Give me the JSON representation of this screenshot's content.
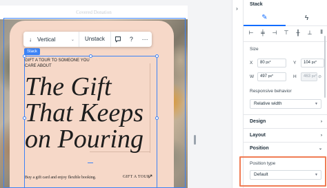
{
  "canvas": {
    "header_ghost": "Covered Donation",
    "stack_tag": "Stack",
    "small_text": "GIFT A TOUR TO SOMEONE YOU CARE ABOUT",
    "headline": "The Gift That Keeps on Pouring",
    "footer_text": "Buy a gift card and enjoy flexible booking.",
    "tour_link": "GIFT A TOUR",
    "tour_arrow_icon": "arrow-up-right-icon"
  },
  "toolbar": {
    "direction_label": "Vertical",
    "unstack_label": "Unstack",
    "icons": [
      "arrow-down-icon",
      "chevron-down-icon",
      "comment-icon",
      "help-icon",
      "more-icon"
    ]
  },
  "panel": {
    "title": "Stack",
    "tabs": [
      "design-tab",
      "interactions-tab"
    ],
    "size_label": "Size",
    "x_label": "X",
    "x_value": "80",
    "x_unit": "px*",
    "y_label": "Y",
    "y_value": "104",
    "y_unit": "px*",
    "w_label": "W",
    "w_value": "497",
    "w_unit": "px*",
    "h_label": "H",
    "h_value": "463",
    "h_unit": "px*",
    "responsive_label": "Responsive behavior",
    "responsive_value": "Relative width",
    "sections": {
      "design": "Design",
      "layout": "Layout",
      "position": "Position"
    },
    "position_type_label": "Position type",
    "position_type_value": "Default"
  },
  "colors": {
    "accent": "#116dff",
    "selection": "#3b82f6",
    "card": "#f6d8c8",
    "highlight": "#f07b53"
  }
}
